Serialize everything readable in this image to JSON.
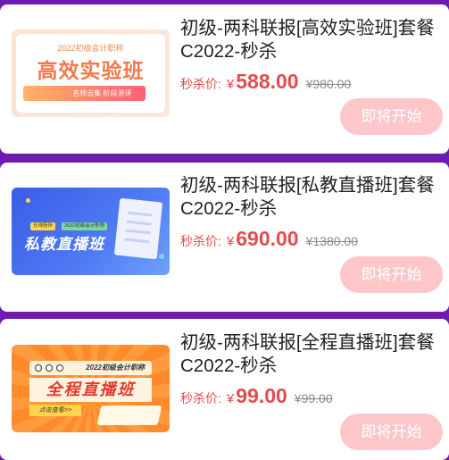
{
  "products": [
    {
      "title": "初级-两科联报[高效实验班]套餐C2022-秒杀",
      "price_label": "秒杀价:",
      "currency": "¥",
      "price": "588.00",
      "original_price": "¥980.00",
      "button_label": "即将开始",
      "thumbnail": {
        "subtitle": "2022初级会计职称",
        "headline": "高效实验班",
        "tagline": "名师云集 阶段测评"
      }
    },
    {
      "title": "初级-两科联报[私教直播班]套餐C2022-秒杀",
      "price_label": "秒杀价:",
      "currency": "¥",
      "price": "690.00",
      "original_price": "¥1380.00",
      "button_label": "即将开始",
      "thumbnail": {
        "tag1": "长线陪伴",
        "tag2": "2022初级会计职称",
        "headline": "私教直播班"
      }
    },
    {
      "title": "初级-两科联报[全程直播班]套餐C2022-秒杀",
      "price_label": "秒杀价:",
      "currency": "¥",
      "price": "99.00",
      "original_price": "¥99.00",
      "button_label": "即将开始",
      "thumbnail": {
        "top_label": "2022初级会计职称",
        "headline": "全程直播班",
        "cta": "点击查看>>"
      }
    }
  ],
  "colors": {
    "background": "#6e1bb0",
    "price": "#e24c4c",
    "button": "#fdc6c9"
  }
}
